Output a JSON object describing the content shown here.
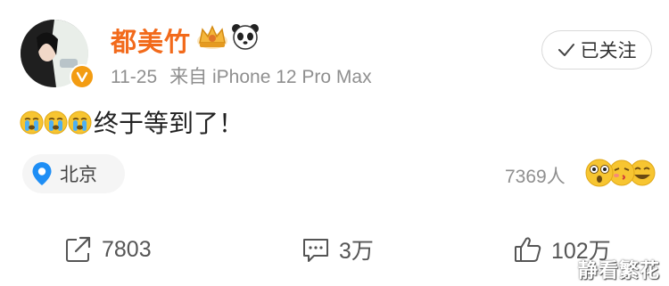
{
  "post": {
    "author": {
      "name": "都美竹",
      "badges": [
        "crown-icon",
        "panda-icon"
      ],
      "verified_badge": "orange-v-badge"
    },
    "meta": {
      "date": "11-25",
      "source": "来自 iPhone 12 Pro Max"
    },
    "follow_button": {
      "label": "已关注",
      "icon": "check-icon"
    },
    "content": {
      "emojis": [
        "crying-face",
        "crying-face",
        "crying-face"
      ],
      "text": "终于等到了！"
    },
    "location": {
      "label": "北京",
      "icon": "location-pin-icon"
    },
    "stats": {
      "reads": "7369人",
      "reaction_icons": [
        "surprised-face",
        "kiss-face",
        "grinning-face"
      ]
    },
    "actions": {
      "share": {
        "count": "7803",
        "icon": "share-icon"
      },
      "comment": {
        "count": "3万",
        "icon": "comment-icon"
      },
      "like": {
        "count": "102万",
        "icon": "thumbs-up-icon"
      }
    }
  },
  "watermark": "静看繁花",
  "colors": {
    "username": "#f26a1b",
    "meta_gray": "#8f8f8f",
    "location_pin": "#1e8ef5",
    "badge_orange": "#f39c12"
  }
}
